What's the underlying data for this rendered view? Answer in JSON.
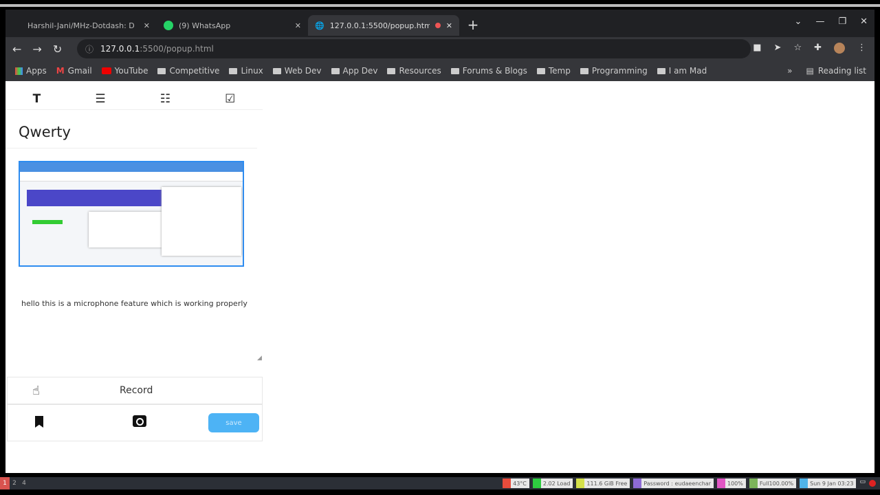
{
  "browser": {
    "tabs": [
      {
        "title": "Harshil-Jani/MHz-Dotdash: D",
        "active": false,
        "icon": "github-icon"
      },
      {
        "title": "(9) WhatsApp",
        "active": false,
        "icon": "whatsapp-icon"
      },
      {
        "title": "127.0.0.1:5500/popup.htm",
        "active": true,
        "icon": "globe-icon",
        "recording": true
      }
    ],
    "url_host": "127.0.0.1",
    "url_rest": ":5500/popup.html",
    "bookmarks": [
      "Apps",
      "Gmail",
      "YouTube",
      "Competitive",
      "Linux",
      "Web Dev",
      "App Dev",
      "Resources",
      "Forums & Blogs",
      "Temp",
      "Programming",
      "I am Mad"
    ],
    "reading_list": "Reading list"
  },
  "page": {
    "format_tools": [
      "T",
      "☰",
      "☷",
      "☑"
    ],
    "title": "Qwerty",
    "note_text": "hello this is a microphone feature which is working properly",
    "record_label": "Record",
    "save_label": "save"
  },
  "taskbar": {
    "workspaces": [
      "1",
      "2",
      "4"
    ],
    "status": [
      {
        "text": "43°C",
        "color": "#e74c3c"
      },
      {
        "text": "2.02 Load",
        "color": "#2ecc40"
      },
      {
        "text": "111.6 GiB Free",
        "color": "#d4e04a"
      },
      {
        "text": "Password : eudaeenchar",
        "color": "#8e6bd6"
      },
      {
        "text": "100%",
        "color": "#e056c4"
      },
      {
        "text": "Full100.00%",
        "color": "#7cb45a"
      },
      {
        "text": "Sun 9 Jan 03:23",
        "color": "#4fb3e8"
      }
    ]
  }
}
